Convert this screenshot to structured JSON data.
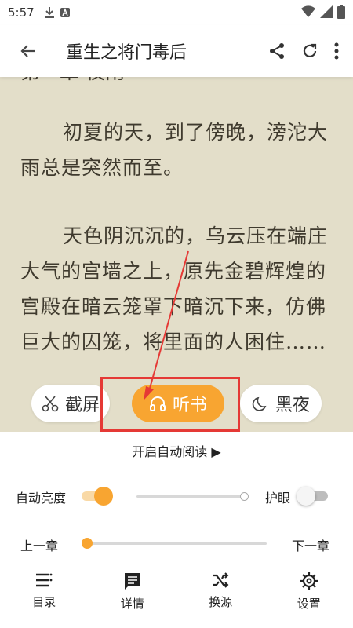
{
  "status_bar": {
    "time": "5:57"
  },
  "app_bar": {
    "title": "重生之将门毒后"
  },
  "reader": {
    "chapter_fragment": "第一章 夜雨",
    "paragraphs": [
      "初夏的天，到了傍晚，滂沱大雨总是突然而至。",
      "天色阴沉沉的，乌云压在端庄大气的宫墙之上，原先金碧辉煌的宫殿在暗云笼罩下暗沉下来，仿佛巨大的囚笼，将里面的人困住……"
    ]
  },
  "floating_actions": {
    "screenshot": "截屏",
    "listen": "听书",
    "night": "黑夜"
  },
  "settings": {
    "auto_read": "开启自动阅读 ▶",
    "auto_brightness": "自动亮度",
    "auto_brightness_on": true,
    "eye_protect": "护眼",
    "eye_protect_on": false,
    "brightness_level": 1.0,
    "prev_chapter": "上一章",
    "next_chapter": "下一章",
    "chapter_progress": 0.0
  },
  "bottom_nav": [
    {
      "icon": "list-icon",
      "label": "目录"
    },
    {
      "icon": "comment-icon",
      "label": "详情"
    },
    {
      "icon": "shuffle-icon",
      "label": "换源"
    },
    {
      "icon": "gear-icon",
      "label": "设置"
    }
  ],
  "colors": {
    "accent": "#f8a531",
    "reader_bg": "#e3dec9",
    "annotation": "#e53935"
  }
}
